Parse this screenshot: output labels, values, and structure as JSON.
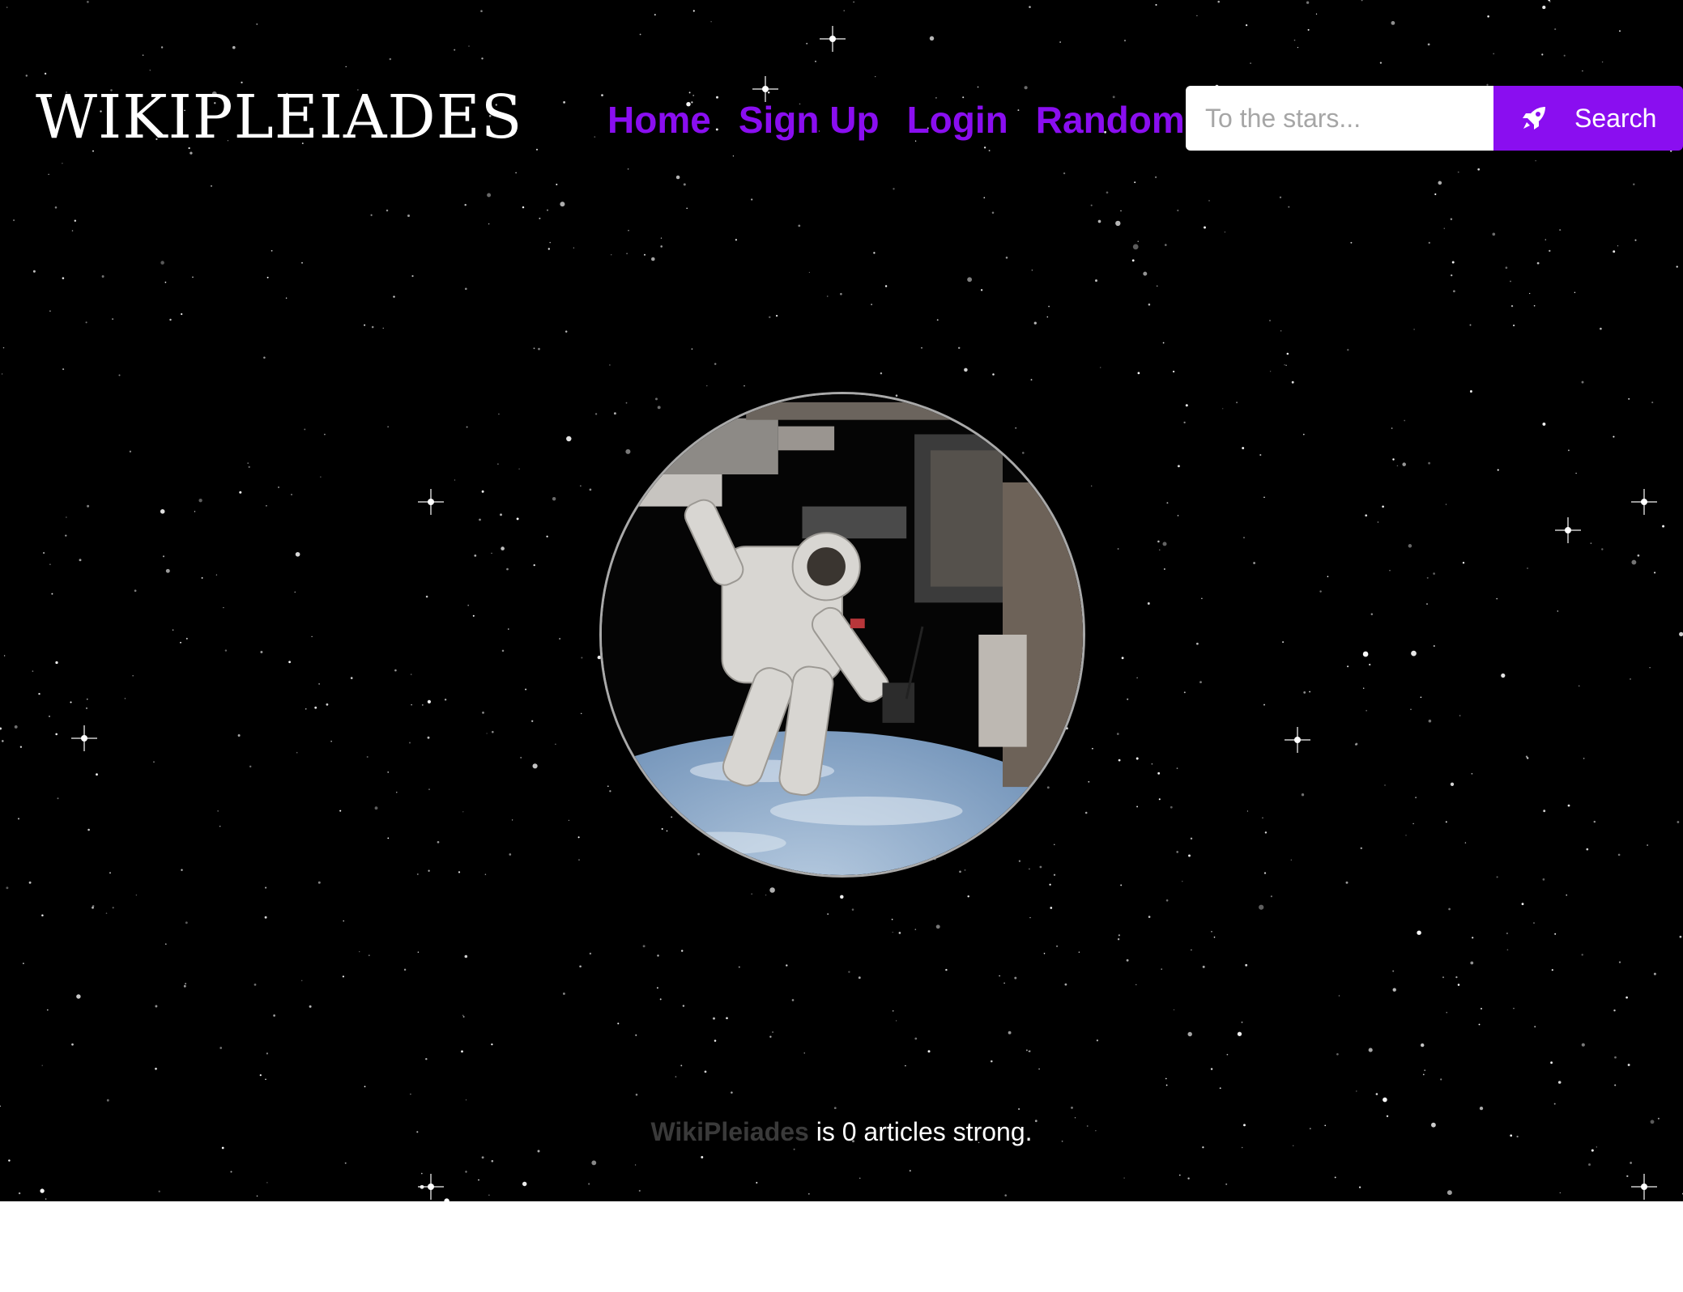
{
  "header": {
    "logo_text": "WIKIPLEIADES",
    "nav": [
      {
        "label": "Home"
      },
      {
        "label": "Sign Up"
      },
      {
        "label": "Login"
      },
      {
        "label": "Random"
      }
    ],
    "search": {
      "placeholder": "To the stars...",
      "value": "",
      "button_label": "Search",
      "button_icon": "rocket-icon"
    }
  },
  "hero": {
    "image_subject": "astronaut spacewalk above Earth",
    "stats": {
      "brand_link": "WikiPleiades",
      "text": " is 0 articles strong."
    }
  },
  "colors": {
    "accent": "#8a0ef0",
    "background": "#000000",
    "footer": "#ffffff"
  }
}
